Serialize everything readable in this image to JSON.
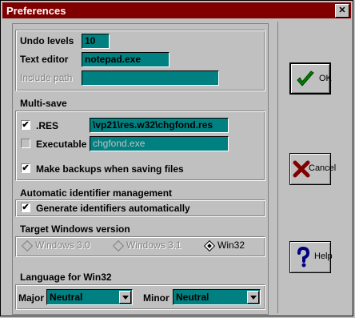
{
  "window": {
    "title": "Preferences"
  },
  "settings": {
    "undo_label": "Undo levels",
    "undo_value": "10",
    "editor_label": "Text editor",
    "editor_value": "notepad.exe",
    "include_label": "Include path",
    "include_value": ""
  },
  "multisave": {
    "heading": "Multi-save",
    "res_label": ".RES",
    "res_checked": true,
    "res_value": "\\vp21\\res.w32\\chgfond.res",
    "exe_label": "Executable",
    "exe_checked": false,
    "exe_value": "chgfond.exe",
    "backup_label": "Make backups when saving files",
    "backup_checked": true
  },
  "autoid": {
    "heading": "Automatic identifier management",
    "generate_label": "Generate identifiers automatically",
    "generate_checked": true
  },
  "target": {
    "heading": "Target Windows version",
    "options": [
      "Windows 3.0",
      "Windows 3.1",
      "Win32"
    ],
    "selected": "Win32"
  },
  "language": {
    "heading": "Language for Win32",
    "major_label": "Major",
    "major_value": "Neutral",
    "minor_label": "Minor",
    "minor_value": "Neutral"
  },
  "buttons": {
    "ok": "OK",
    "cancel": "Cancel",
    "help": "Help"
  },
  "icons": {
    "ok": "check-icon",
    "cancel": "x-icon",
    "help": "question-icon",
    "close": "close-icon"
  },
  "colors": {
    "titlebar": "#800000",
    "field": "#008080",
    "ok_icon": "#008000",
    "cancel_icon": "#800000",
    "help_icon": "#000080"
  }
}
